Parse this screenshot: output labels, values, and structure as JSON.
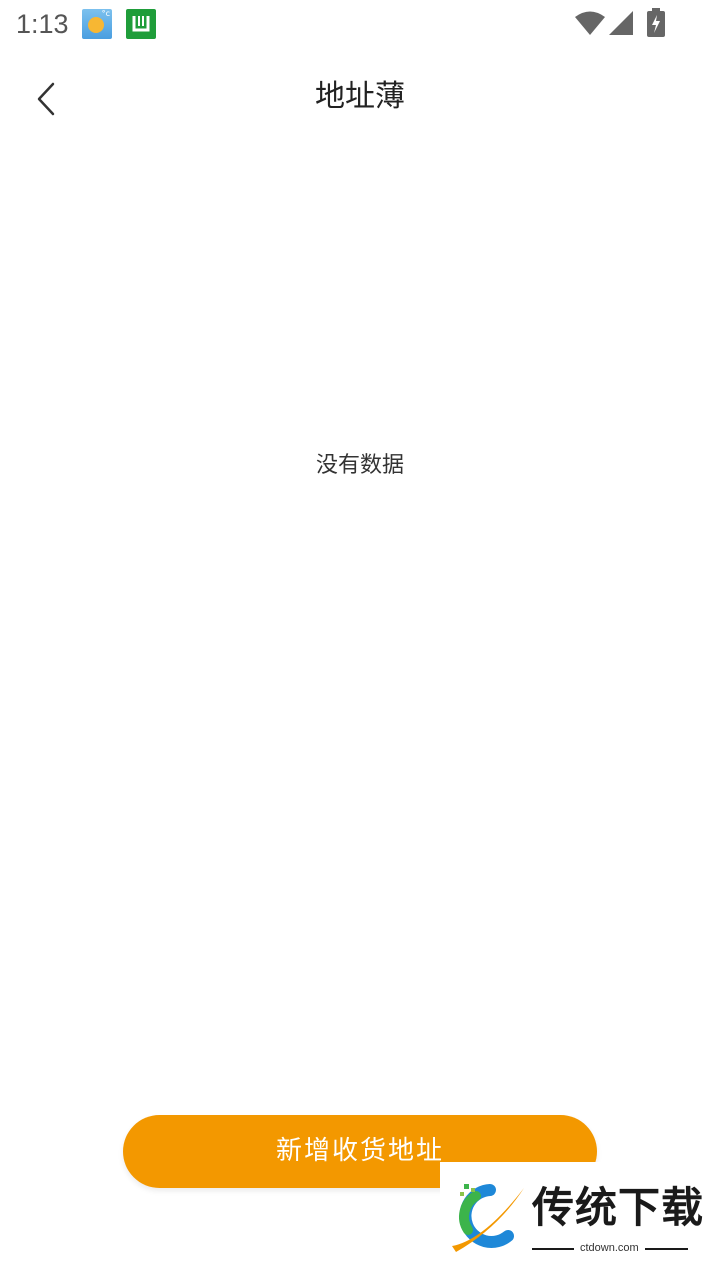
{
  "status_bar": {
    "time": "1:13",
    "icons": [
      "weather-icon",
      "app-badge-icon",
      "wifi-icon",
      "signal-icon",
      "battery-charging-icon"
    ]
  },
  "header": {
    "title": "地址薄",
    "back_icon": "chevron-left-icon"
  },
  "empty_state": {
    "message": "没有数据"
  },
  "actions": {
    "add_address_label": "新增收货地址"
  },
  "watermark": {
    "brand": "传统下载",
    "domain": "ctdown.com"
  },
  "colors": {
    "accent": "#f39800",
    "background": "#ffffff",
    "text": "#222222"
  }
}
